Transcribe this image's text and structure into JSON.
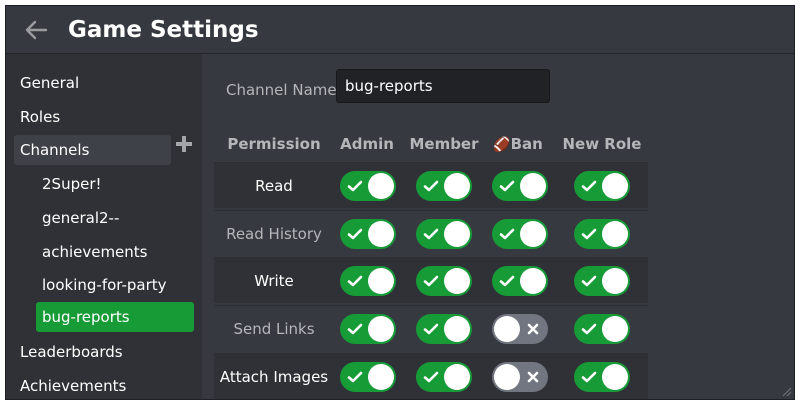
{
  "window": {
    "title": "Game Settings"
  },
  "sidebar": {
    "items": [
      {
        "label": "General"
      },
      {
        "label": "Roles"
      },
      {
        "label": "Channels"
      },
      {
        "label": "Leaderboards"
      },
      {
        "label": "Achievements"
      }
    ],
    "channels": [
      {
        "label": "2Super!"
      },
      {
        "label": "general2--"
      },
      {
        "label": "achievements"
      },
      {
        "label": "looking-for-party"
      },
      {
        "label": "bug-reports"
      }
    ],
    "selected_channel": "bug-reports"
  },
  "channel": {
    "name_label": "Channel Name",
    "name_value": "bug-reports"
  },
  "permissions": {
    "columns": [
      {
        "label": "Permission"
      },
      {
        "label": "Admin"
      },
      {
        "label": "Member"
      },
      {
        "label": "Ban",
        "emoji": "🏈"
      },
      {
        "label": "New Role"
      }
    ],
    "rows": [
      {
        "label": "Read",
        "highlight": true,
        "values": [
          true,
          true,
          true,
          true
        ]
      },
      {
        "label": "Read History",
        "highlight": false,
        "values": [
          true,
          true,
          true,
          true
        ]
      },
      {
        "label": "Write",
        "highlight": true,
        "values": [
          true,
          true,
          true,
          true
        ]
      },
      {
        "label": "Send Links",
        "highlight": false,
        "values": [
          true,
          true,
          false,
          true
        ]
      },
      {
        "label": "Attach Images",
        "highlight": true,
        "values": [
          true,
          true,
          false,
          true
        ]
      }
    ]
  },
  "icons": {
    "back": "arrow-left-icon",
    "add": "plus-icon",
    "on": "check-icon",
    "off": "x-icon",
    "resize": "resize-grip-icon"
  },
  "colors": {
    "accent_green": "#179b36",
    "toggle_off": "#727680",
    "background": "#36393f"
  }
}
